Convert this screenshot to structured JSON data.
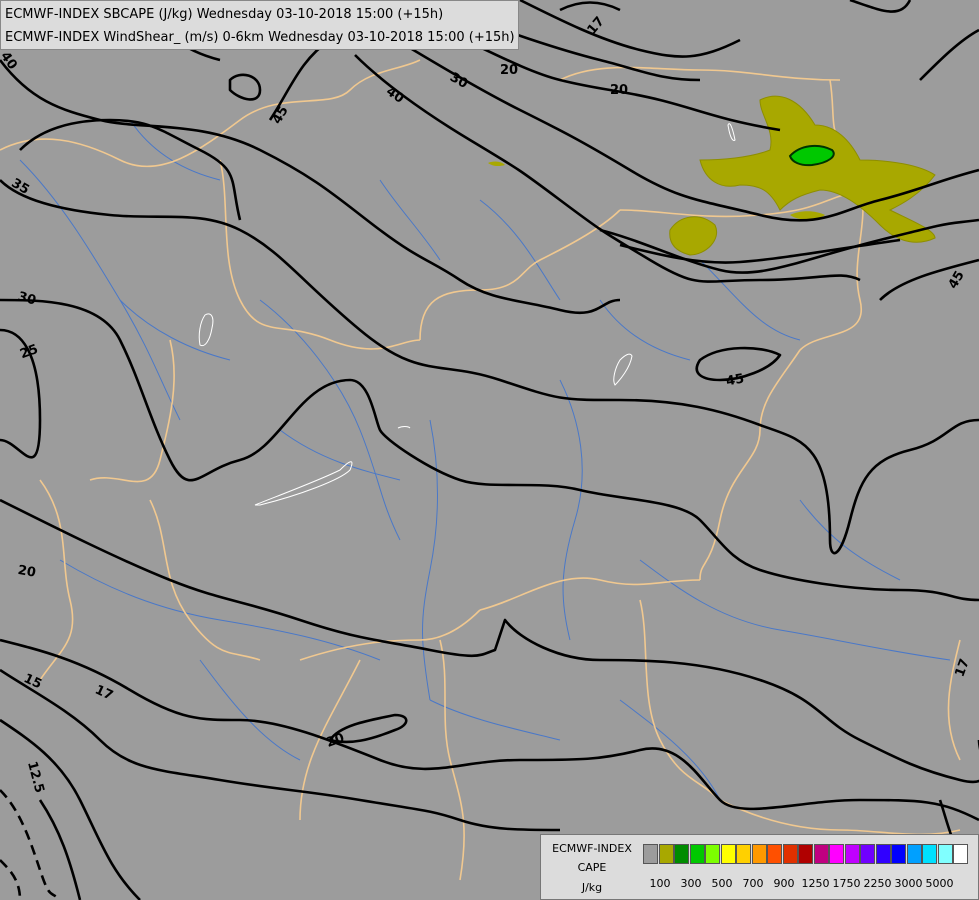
{
  "header": {
    "line1": "ECMWF-INDEX SBCAPE (J/kg) Wednesday 03-10-2018 15:00 (+15h)",
    "line2": "ECMWF-INDEX WindShear_ (m/s) 0-6km Wednesday 03-10-2018 15:00 (+15h)"
  },
  "contour_labels": [
    "40",
    "40",
    "45",
    "30",
    "20",
    "20",
    "17",
    "35",
    "30",
    "25",
    "45",
    "45",
    "20",
    "15",
    "17",
    "20",
    "12.5",
    "17"
  ],
  "legend": {
    "model": "ECMWF-INDEX",
    "field": "CAPE",
    "unit": "J/kg",
    "colors": [
      "#9c9c9c",
      "#a8a800",
      "#008c00",
      "#00c800",
      "#7cff00",
      "#ffff00",
      "#ffd000",
      "#ff9900",
      "#ff5000",
      "#e03000",
      "#b00000",
      "#c00080",
      "#ff00ff",
      "#c000ff",
      "#7000ff",
      "#3000ff",
      "#0000ff",
      "#00a0ff",
      "#00e0ff",
      "#80ffff",
      "#ffffff"
    ],
    "ticks": [
      "100",
      "300",
      "500",
      "700",
      "900",
      "1250",
      "1750",
      "2250",
      "3000",
      "5000"
    ]
  },
  "colors": {
    "background": "#9c9c9c",
    "borders": "#f0c890",
    "rivers": "#4a78c8",
    "contours": "#000000",
    "cape_low": "#a8a800"
  }
}
